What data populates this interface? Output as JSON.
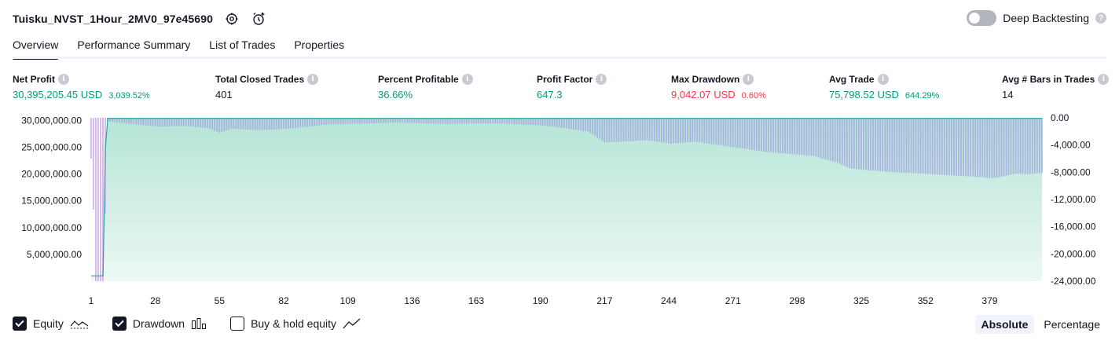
{
  "header": {
    "strategy_title": "Tuisku_NVST_1Hour_2MV0_97e45690",
    "deep_backtesting_label": "Deep Backtesting",
    "deep_backtesting_enabled": false,
    "settings_icon": "gear-icon",
    "alert_icon": "add-alert-icon"
  },
  "tabs": [
    {
      "label": "Overview",
      "active": true
    },
    {
      "label": "Performance Summary",
      "active": false
    },
    {
      "label": "List of Trades",
      "active": false
    },
    {
      "label": "Properties",
      "active": false
    }
  ],
  "metrics": {
    "net_profit": {
      "label": "Net Profit",
      "value": "30,395,205.45 USD",
      "sub": "3,039.52%"
    },
    "total_closed_trades": {
      "label": "Total Closed Trades",
      "value": "401"
    },
    "percent_profitable": {
      "label": "Percent Profitable",
      "value": "36.66%"
    },
    "profit_factor": {
      "label": "Profit Factor",
      "value": "647.3"
    },
    "max_drawdown": {
      "label": "Max Drawdown",
      "value": "9,042.07 USD",
      "sub": "0.60%"
    },
    "avg_trade": {
      "label": "Avg Trade",
      "value": "75,798.52 USD",
      "sub": "644.29%"
    },
    "avg_bars": {
      "label": "Avg # Bars in Trades",
      "value": "14"
    }
  },
  "colors": {
    "positive": "#089981",
    "negative": "#f23645",
    "equity_fill": "#a8e0cf",
    "equity_line": "#26a69a",
    "drawdown_bar": "#aab4e0",
    "drawdown_bar_early": "#d4b4ee"
  },
  "chart_data": {
    "type": "area",
    "left_axis": {
      "ticks": [
        "30,000,000.00",
        "25,000,000.00",
        "20,000,000.00",
        "15,000,000.00",
        "10,000,000.00",
        "5,000,000.00"
      ],
      "values": [
        30000000,
        25000000,
        20000000,
        15000000,
        10000000,
        5000000
      ],
      "ylim": [
        0,
        30500000
      ]
    },
    "right_axis": {
      "ticks": [
        "0.00",
        "-4,000.00",
        "-8,000.00",
        "-12,000.00",
        "-16,000.00",
        "-20,000.00",
        "-24,000.00"
      ],
      "values": [
        0,
        -4000,
        -8000,
        -12000,
        -16000,
        -20000,
        -24000
      ],
      "ylim": [
        -24000,
        0
      ]
    },
    "x_ticks": [
      "1",
      "28",
      "55",
      "82",
      "109",
      "136",
      "163",
      "190",
      "217",
      "244",
      "271",
      "298",
      "325",
      "352",
      "379"
    ],
    "x_tick_values": [
      1,
      28,
      55,
      82,
      109,
      136,
      163,
      190,
      217,
      244,
      271,
      298,
      325,
      352,
      379
    ],
    "xlim": [
      1,
      401
    ],
    "series": [
      {
        "name": "Equity",
        "x": [
          1,
          3,
          4,
          5,
          6,
          7,
          8,
          401
        ],
        "values": [
          1000000,
          1000000,
          1000000,
          1000000,
          1000000,
          25000000,
          30400000,
          30400000
        ]
      },
      {
        "name": "Drawdown",
        "x": [
          1,
          2,
          3,
          4,
          5,
          6,
          7,
          8,
          20,
          30,
          40,
          50,
          55,
          60,
          70,
          80,
          90,
          100,
          110,
          130,
          150,
          170,
          190,
          200,
          210,
          217,
          225,
          235,
          245,
          255,
          265,
          275,
          285,
          295,
          305,
          315,
          320,
          325,
          335,
          345,
          355,
          365,
          375,
          380,
          385,
          390,
          395,
          401
        ],
        "values": [
          -6000,
          -13500,
          -24000,
          -24000,
          -24000,
          -24000,
          -14000,
          -500,
          -1000,
          -1300,
          -1200,
          -1500,
          -2200,
          -1600,
          -1800,
          -1700,
          -1400,
          -1000,
          -900,
          -700,
          -900,
          -800,
          -1100,
          -1500,
          -2000,
          -3600,
          -3500,
          -3300,
          -3800,
          -3500,
          -4000,
          -4500,
          -5000,
          -5300,
          -5600,
          -6600,
          -7400,
          -7600,
          -7900,
          -8100,
          -8300,
          -8500,
          -8700,
          -8900,
          -8600,
          -8200,
          -8300,
          -8100
        ]
      }
    ]
  },
  "legend": [
    {
      "label": "Equity",
      "checked": true,
      "icon": "equity-area-icon"
    },
    {
      "label": "Drawdown",
      "checked": true,
      "icon": "drawdown-bars-icon"
    },
    {
      "label": "Buy & hold equity",
      "checked": false,
      "icon": "line-chart-icon"
    }
  ],
  "modes": [
    {
      "label": "Absolute",
      "active": true
    },
    {
      "label": "Percentage",
      "active": false
    }
  ]
}
